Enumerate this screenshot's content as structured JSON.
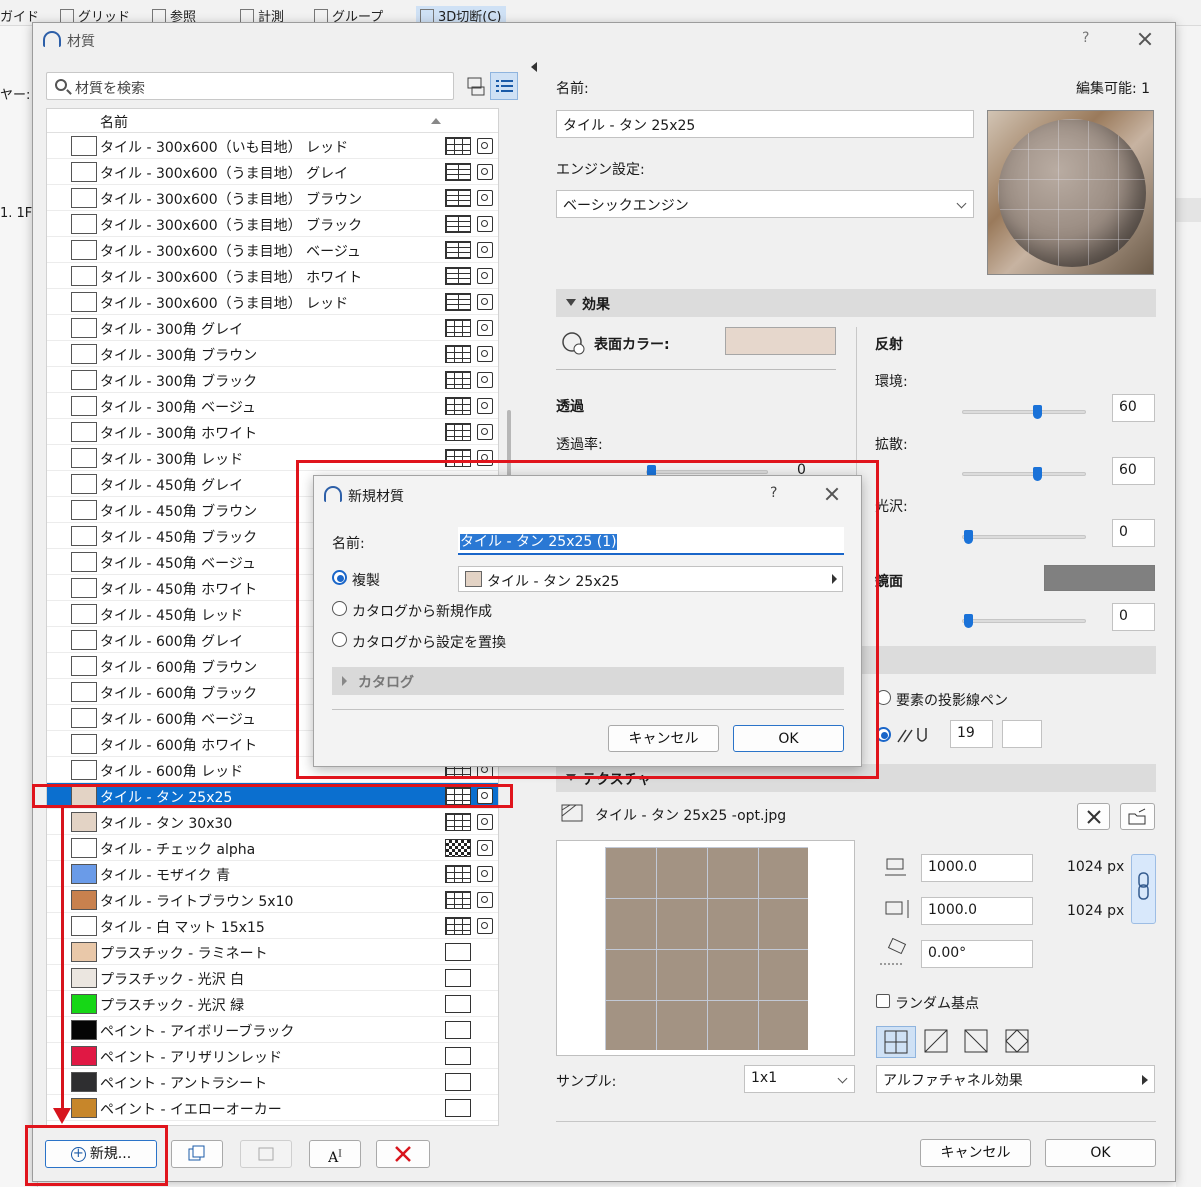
{
  "bg_toolbar": {
    "items": [
      "ガイド",
      "グリッド",
      "参照",
      "計測",
      "グループ",
      "3D切断(C)"
    ],
    "left_labels": [
      "ヤー:",
      "1. 1F"
    ]
  },
  "dialog": {
    "title": "材質",
    "help": "?",
    "close": "×"
  },
  "search": {
    "placeholder": "材質を検索"
  },
  "list": {
    "header": "名前",
    "items": [
      {
        "name": "タイル - 300x600（いも目地） レッド",
        "color": "#ffffff",
        "pattern": "grid",
        "tex": true
      },
      {
        "name": "タイル - 300x600（うま目地） グレイ",
        "color": "#ffffff",
        "pattern": "brick",
        "tex": true
      },
      {
        "name": "タイル - 300x600（うま目地） ブラウン",
        "color": "#ffffff",
        "pattern": "brick",
        "tex": true
      },
      {
        "name": "タイル - 300x600（うま目地） ブラック",
        "color": "#ffffff",
        "pattern": "brick",
        "tex": true
      },
      {
        "name": "タイル - 300x600（うま目地） ベージュ",
        "color": "#ffffff",
        "pattern": "brick",
        "tex": true
      },
      {
        "name": "タイル - 300x600（うま目地） ホワイト",
        "color": "#ffffff",
        "pattern": "brick",
        "tex": true
      },
      {
        "name": "タイル - 300x600（うま目地） レッド",
        "color": "#ffffff",
        "pattern": "brick",
        "tex": true
      },
      {
        "name": "タイル - 300角 グレイ",
        "color": "#ffffff",
        "pattern": "grid",
        "tex": true
      },
      {
        "name": "タイル - 300角 ブラウン",
        "color": "#ffffff",
        "pattern": "grid",
        "tex": true
      },
      {
        "name": "タイル - 300角 ブラック",
        "color": "#ffffff",
        "pattern": "grid",
        "tex": true
      },
      {
        "name": "タイル - 300角 ベージュ",
        "color": "#ffffff",
        "pattern": "grid",
        "tex": true
      },
      {
        "name": "タイル - 300角 ホワイト",
        "color": "#ffffff",
        "pattern": "grid",
        "tex": true
      },
      {
        "name": "タイル - 300角 レッド",
        "color": "#ffffff",
        "pattern": "grid",
        "tex": true
      },
      {
        "name": "タイル - 450角 グレイ",
        "color": "#ffffff",
        "pattern": "grid",
        "tex": true
      },
      {
        "name": "タイル - 450角 ブラウン",
        "color": "#ffffff",
        "pattern": "grid",
        "tex": true
      },
      {
        "name": "タイル - 450角 ブラック",
        "color": "#ffffff",
        "pattern": "grid",
        "tex": true
      },
      {
        "name": "タイル - 450角 ベージュ",
        "color": "#ffffff",
        "pattern": "grid",
        "tex": true
      },
      {
        "name": "タイル - 450角 ホワイト",
        "color": "#ffffff",
        "pattern": "grid",
        "tex": true
      },
      {
        "name": "タイル - 450角 レッド",
        "color": "#ffffff",
        "pattern": "grid",
        "tex": true
      },
      {
        "name": "タイル - 600角 グレイ",
        "color": "#ffffff",
        "pattern": "grid",
        "tex": true
      },
      {
        "name": "タイル - 600角 ブラウン",
        "color": "#ffffff",
        "pattern": "grid",
        "tex": true
      },
      {
        "name": "タイル - 600角 ブラック",
        "color": "#ffffff",
        "pattern": "grid",
        "tex": true
      },
      {
        "name": "タイル - 600角 ベージュ",
        "color": "#ffffff",
        "pattern": "grid",
        "tex": true
      },
      {
        "name": "タイル - 600角 ホワイト",
        "color": "#ffffff",
        "pattern": "grid",
        "tex": true
      },
      {
        "name": "タイル - 600角 レッド",
        "color": "#ffffff",
        "pattern": "grid",
        "tex": true
      },
      {
        "name": "タイル - タン 25x25",
        "color": "#e3d3c5",
        "pattern": "grid",
        "tex": true,
        "selected": true
      },
      {
        "name": "タイル - タン 30x30",
        "color": "#e3d3c5",
        "pattern": "grid",
        "tex": true
      },
      {
        "name": "タイル - チェック alpha",
        "color": "#ffffff",
        "pattern": "checker",
        "tex": true
      },
      {
        "name": "タイル - モザイク 青",
        "color": "#6a9be8",
        "pattern": "grid",
        "tex": true
      },
      {
        "name": "タイル - ライトブラウン 5x10",
        "color": "#c8814e",
        "pattern": "grid",
        "tex": true
      },
      {
        "name": "タイル - 白 マット 15x15",
        "color": "#ffffff",
        "pattern": "grid",
        "tex": true
      },
      {
        "name": "プラスチック - ラミネート",
        "color": "#e9c8a9",
        "pattern": "empty",
        "tex": false
      },
      {
        "name": "プラスチック - 光沢 白",
        "color": "#ebe6e0",
        "pattern": "empty",
        "tex": false
      },
      {
        "name": "プラスチック - 光沢 緑",
        "color": "#16d716",
        "pattern": "empty",
        "tex": false
      },
      {
        "name": "ペイント - アイボリーブラック",
        "color": "#050505",
        "pattern": "empty",
        "tex": false
      },
      {
        "name": "ペイント - アリザリンレッド",
        "color": "#e01844",
        "pattern": "empty",
        "tex": false
      },
      {
        "name": "ペイント - アントラシート",
        "color": "#2e2e30",
        "pattern": "empty",
        "tex": false
      },
      {
        "name": "ペイント - イエローオーカー",
        "color": "#c7862a",
        "pattern": "empty",
        "tex": false
      }
    ]
  },
  "bottom_buttons": {
    "new": "新規...",
    "cancel": "キャンセル",
    "ok": "OK"
  },
  "details": {
    "name_label": "名前:",
    "editable": "編集可能: 1",
    "name_value": "タイル - タン 25x25",
    "engine_label": "エンジン設定:",
    "engine_value": "ベーシックエンジン",
    "effects_section": "効果",
    "surface_color_label": "表面カラー:",
    "surface_color": "#e6d7cc",
    "transparency_label": "透過",
    "transparency_rate_label": "透過率:",
    "transparency_value": "0",
    "reflection_label": "反射",
    "ambient_label": "環境:",
    "ambient_value": "60",
    "diffuse_label": "拡散:",
    "diffuse_value": "60",
    "gloss_label": "光沢:",
    "gloss_value": "0",
    "specular_label": "鏡面",
    "specular_color": "#808080",
    "specular_value": "0",
    "pen_option": "要素の投影線ペン",
    "pen_value": "19",
    "texture_section": "テクスチャ",
    "texture_file": "タイル - タン 25x25 -opt.jpg",
    "tex_width": "1000.0",
    "tex_width_px": "1024 px",
    "tex_height": "1000.0",
    "tex_height_px": "1024 px",
    "tex_angle": "0.00°",
    "random_origin": "ランダム基点",
    "sample_label": "サンプル:",
    "sample_value": "1x1",
    "alpha_effect": "アルファチャネル効果"
  },
  "new_material_dialog": {
    "title": "新規材質",
    "help": "?",
    "name_label": "名前:",
    "name_value": "タイル - タン 25x25 (1)",
    "duplicate": "複製",
    "duplicate_source": "タイル - タン 25x25",
    "from_catalog": "カタログから新規作成",
    "replace_from_catalog": "カタログから設定を置換",
    "catalog_section": "カタログ",
    "cancel": "キャンセル",
    "ok": "OK"
  },
  "accent_color": "#0b6fcf",
  "annotation_color": "#e0141c"
}
